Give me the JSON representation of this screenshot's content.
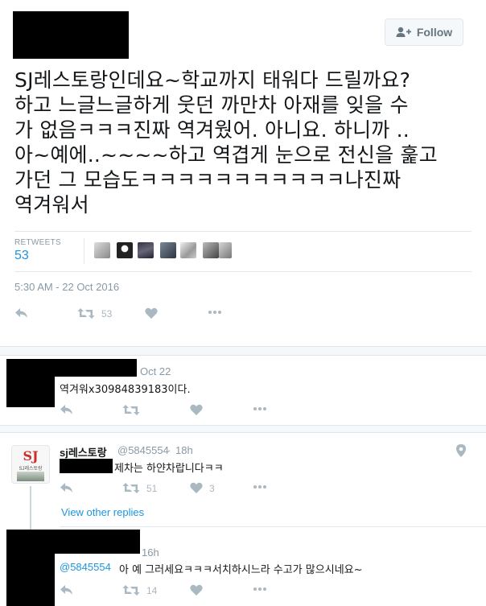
{
  "header": {
    "follow_label": "Follow"
  },
  "tweet": {
    "text": "SJ레스토랑인데요~학교까지 태워다 드릴까요?\n하고 느글느글하게 웃던 까만차 아재를 잊을 수\n가 없음ㅋㅋㅋ진짜 역겨웠어. 아니요. 하니까 ..\n아~예에..~~~~하고 역겹게 눈으로 전신을 훑고\n가던 그 모습도ㅋㅋㅋㅋㅋㅋㅋㅋㅋㅋㅋ나진짜\n역겨워서",
    "retweets_label": "RETWEETS",
    "retweets_count": "53",
    "timestamp": "5:30 AM - 22 Oct 2016",
    "actions": {
      "reply_icon": "reply-icon",
      "retweet_icon": "retweet-icon",
      "retweet_count": "53",
      "like_icon": "heart-icon",
      "more_icon": "more-icon"
    }
  },
  "replies": [
    {
      "date": "Oct 22",
      "text": "역겨워x30984839183이다."
    },
    {
      "name": "sj레스토랑",
      "handle": "@5845554",
      "time": "18h",
      "text": "제차는 하얀차랍니다ㅋㅋ",
      "retweet_count": "51",
      "like_count": "3",
      "avatar_text": "SJ",
      "avatar_subtext": "SJ레스토랑"
    },
    {
      "time": "16h",
      "mention": "@5845554",
      "text": "아 예 그러세요ㅋㅋㅋ서치하시느라 수고가 많으시네요~",
      "retweet_count": "14"
    }
  ],
  "view_other_replies": "View other replies",
  "colors": {
    "accent": "#1b95e0",
    "muted": "#8899a6",
    "icon": "#aab8c2"
  }
}
